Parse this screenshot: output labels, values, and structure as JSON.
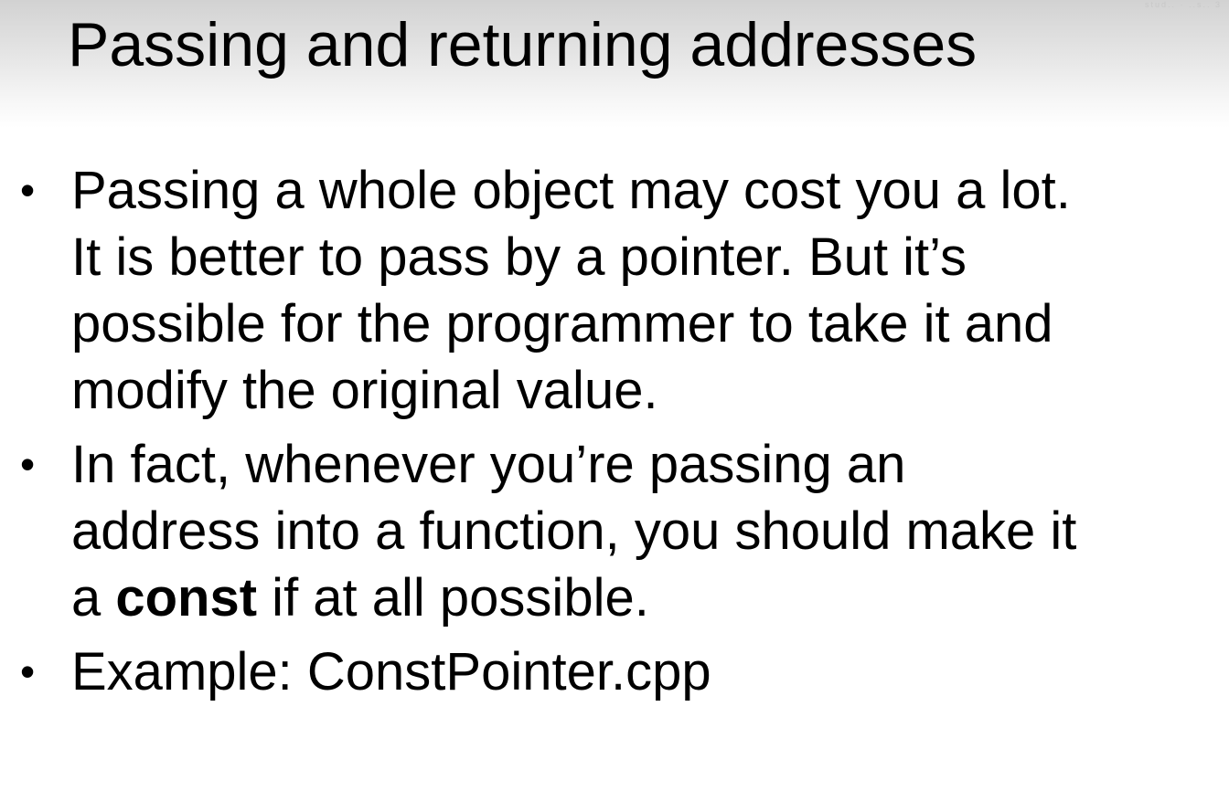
{
  "slide": {
    "title": "Passing and returning addresses",
    "watermark": "stud.. · ..s.. 3",
    "bullet_symbol": "•",
    "bullets": [
      {
        "lines": [
          "Passing a whole object may cost you a lot.",
          "It is better to pass by a pointer.  But it’s",
          "possible for the programmer to take it and",
          "modify the original value."
        ]
      },
      {
        "lines": [
          "In fact, whenever you’re passing an",
          "address into a function, you should make it"
        ],
        "last_line": {
          "before": "a ",
          "keyword": "const",
          "after": " if at all possible."
        }
      },
      {
        "lines": [
          "Example: ConstPointer.cpp"
        ]
      }
    ]
  }
}
